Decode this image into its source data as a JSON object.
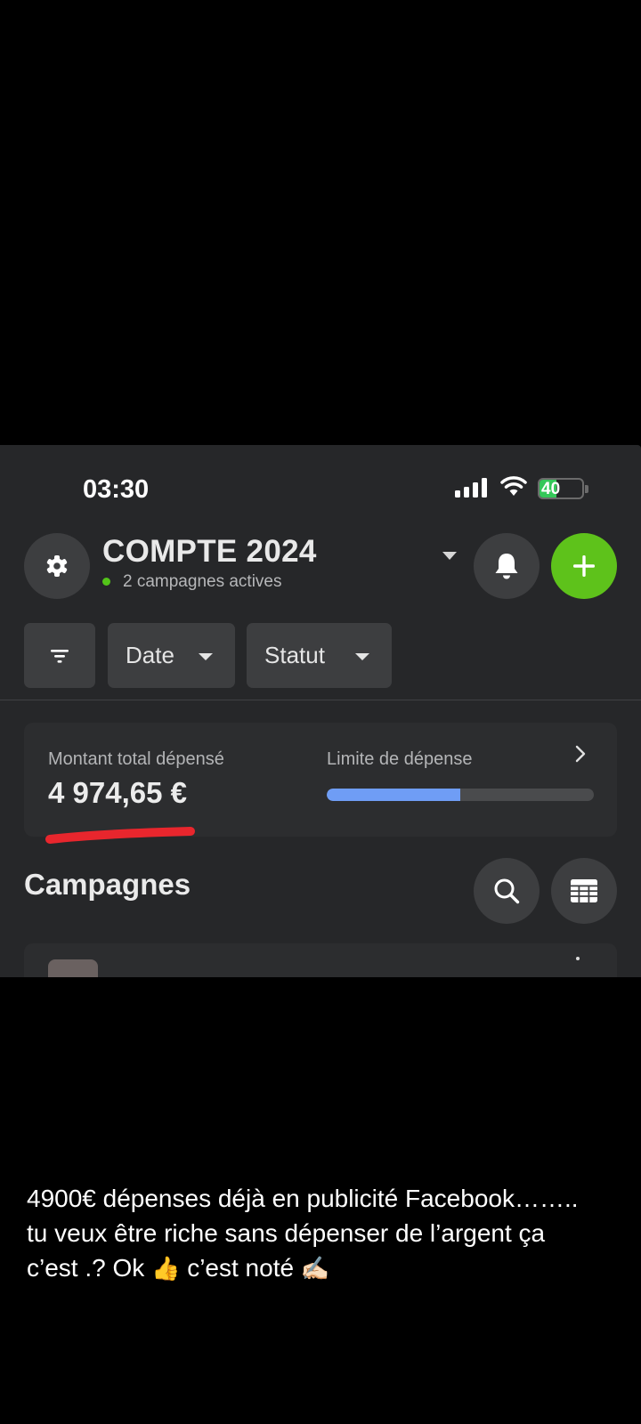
{
  "status_bar": {
    "time": "03:30",
    "battery": "40"
  },
  "header": {
    "account_title": "COMPTE 2024",
    "active_campaigns": "2 campagnes actives"
  },
  "filters": {
    "date_label": "Date",
    "status_label": "Statut"
  },
  "spend": {
    "total_label": "Montant total dépensé",
    "total_value": "4 974,65 €",
    "limit_label": "Limite de dépense",
    "limit_progress": 0.5
  },
  "campaigns": {
    "title": "Campagnes"
  },
  "caption": {
    "line1": "4900€ dépenses déjà en publicité Facebook……..",
    "line2": "tu veux être riche sans dépenser de l’argent ça",
    "line3_a": "c’est .? Ok",
    "line3_b": "c’est noté",
    "emoji_thumb": "👍",
    "emoji_writing": "✍🏻"
  },
  "colors": {
    "accent_green": "#5ec21b",
    "progress_blue": "#6f9df5",
    "active_dot": "#53c419",
    "battery_green": "#34c759",
    "highlight_red": "#e8262d"
  },
  "icons": [
    "gear-icon",
    "bell-icon",
    "plus-icon",
    "filter-icon",
    "search-icon",
    "table-icon",
    "chevron-right-icon"
  ]
}
